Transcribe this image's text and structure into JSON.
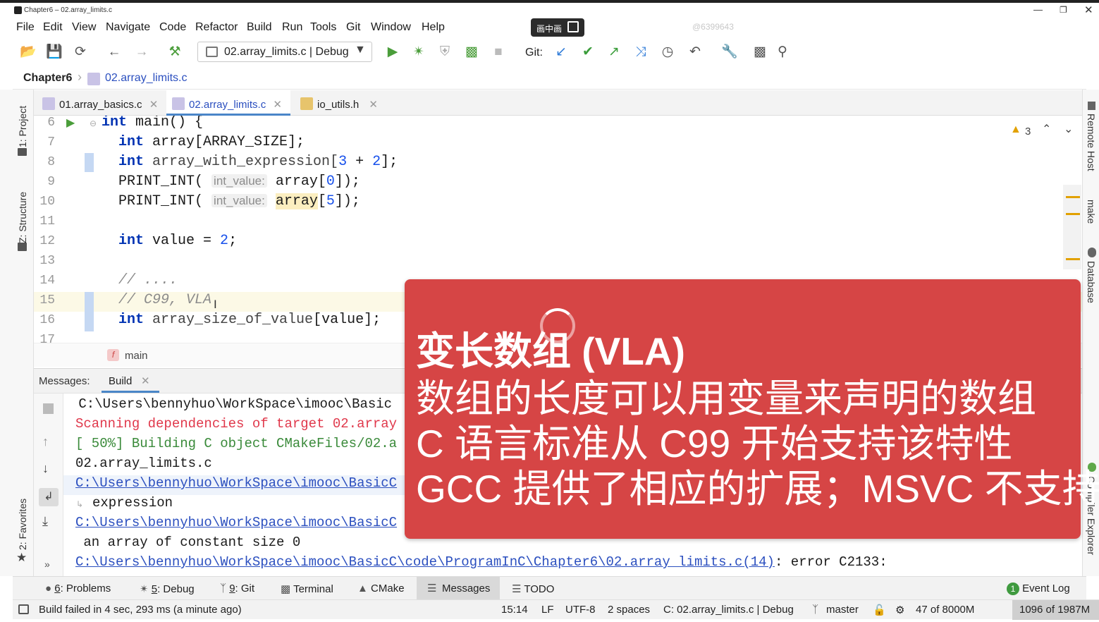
{
  "window": {
    "title": "Chapter6 – 02.array_limits.c",
    "watermark": "@6399643",
    "pip_label": "画中画"
  },
  "menu": [
    "File",
    "Edit",
    "View",
    "Navigate",
    "Code",
    "Refactor",
    "Build",
    "Run",
    "Tools",
    "Git",
    "Window",
    "Help"
  ],
  "toolbar": {
    "config_label": "02.array_limits.c | Debug",
    "git_label": "Git:"
  },
  "breadcrumb": {
    "project": "Chapter6",
    "file": "02.array_limits.c"
  },
  "tabs": [
    {
      "label": "01.array_basics.c",
      "icon": "c-file-icon"
    },
    {
      "label": "02.array_limits.c",
      "icon": "c-file-icon"
    },
    {
      "label": "io_utils.h",
      "icon": "h-file-icon"
    }
  ],
  "left_panels": [
    "1: Project",
    "Z: Structure",
    "2: Favorites"
  ],
  "right_panels": [
    "Remote Host",
    "make",
    "Database",
    "Compiler Explorer"
  ],
  "editor": {
    "warning_count": "3",
    "line_numbers": [
      "6",
      "7",
      "8",
      "9",
      "10",
      "11",
      "12",
      "13",
      "14",
      "15",
      "16",
      "17"
    ],
    "lines": {
      "l6_kw": "int",
      "l6_rest": " main() {",
      "l7_kw": "int",
      "l7_rest": " array[ARRAY_SIZE];",
      "l8_kw": "int",
      "l8_var": " array_with_expression[",
      "l8_n1": "3",
      "l8_op": " + ",
      "l8_n2": "2",
      "l8_end": "];",
      "l9_macro": "PRINT_INT(",
      "l9_hint": "int_value:",
      "l9_arg": " array[",
      "l9_n": "0",
      "l9_end": "]);",
      "l10_macro": "PRINT_INT(",
      "l10_hint": "int_value:",
      "l10_arg": "array",
      "l10_b": "[",
      "l10_n": "5",
      "l10_end": "]);",
      "l12_kw": "int",
      "l12_rest": " value = ",
      "l12_n": "2",
      "l12_end": ";",
      "l14_cm": "// ....",
      "l15_cm": "// C99, VLA",
      "l16_kw": "int",
      "l16_var": " array_size_of_value",
      "l16_end": "[value];"
    },
    "function_crumb": "main"
  },
  "messages": {
    "label": "Messages:",
    "tab": "Build",
    "lines": [
      " C:\\Users\\bennyhuo\\WorkSpace\\imooc\\Basic",
      "Scanning dependencies of target 02.array",
      "[ 50%] Building C object CMakeFiles/02.a",
      "02.array_limits.c",
      "C:\\Users\\bennyhuo\\WorkSpace\\imooc\\BasicC",
      "expression",
      "C:\\Users\\bennyhuo\\WorkSpace\\imooc\\BasicC",
      " an array of constant size 0",
      "C:\\Users\\bennyhuo\\WorkSpace\\imooc\\BasicC\\code\\ProgramInC\\Chapter6\\02.array_limits.c(14)",
      ": error C2133:"
    ]
  },
  "tool_windows": [
    {
      "key": "6",
      "label": ": Problems"
    },
    {
      "key": "5",
      "label": ": Debug"
    },
    {
      "key": "9",
      "label": ": Git"
    },
    {
      "key": "",
      "label": "Terminal"
    },
    {
      "key": "",
      "label": "CMake"
    },
    {
      "key": "",
      "label": "Messages"
    },
    {
      "key": "",
      "label": "TODO"
    }
  ],
  "event_log": {
    "count": "1",
    "label": "Event Log"
  },
  "status": {
    "message": "Build failed in 4 sec, 293 ms (a minute ago)",
    "position": "15:14",
    "line_sep": "LF",
    "encoding": "UTF-8",
    "indent": "2 spaces",
    "context": "C: 02.array_limits.c | Debug",
    "branch": "master",
    "memory1": "47 of 8000M",
    "memory2": "1096 of 1987M"
  },
  "overlay": {
    "title_cn": "变长数组",
    "title_en": "(VLA)",
    "line1": "数组的长度可以用变量来声明的数组",
    "line2": "C 语言标准从 C99 开始支持该特性",
    "line3": "GCC 提供了相应的扩展；MSVC 不支持",
    "color": "#d64545"
  },
  "colors": {
    "keyword": "#0033b3",
    "number": "#1750eb",
    "error_text": "#e0384b",
    "link": "#2b4fbf",
    "accent": "#4a86c8"
  }
}
